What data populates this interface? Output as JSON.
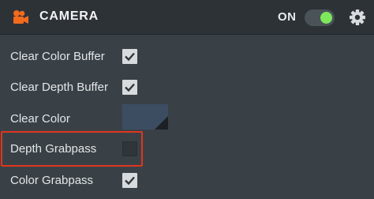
{
  "header": {
    "title": "CAMERA",
    "toggle_label": "ON",
    "toggle_on": true,
    "icon": "camera-icon",
    "settings_icon": "gear-icon"
  },
  "rows": [
    {
      "label": "Clear Color Buffer",
      "type": "checkbox",
      "checked": true
    },
    {
      "label": "Clear Depth Buffer",
      "type": "checkbox",
      "checked": true
    },
    {
      "label": "Clear Color",
      "type": "color",
      "color": "#3c4d62"
    },
    {
      "label": "Depth Grabpass",
      "type": "checkbox",
      "checked": false,
      "highlighted": true
    },
    {
      "label": "Color Grabpass",
      "type": "checkbox",
      "checked": true
    }
  ],
  "colors": {
    "background": "#3a4146",
    "header": "#2d3237",
    "accent_orange": "#f26b1d",
    "toggle_green": "#7ee85b",
    "highlight_red": "#e0351e"
  }
}
